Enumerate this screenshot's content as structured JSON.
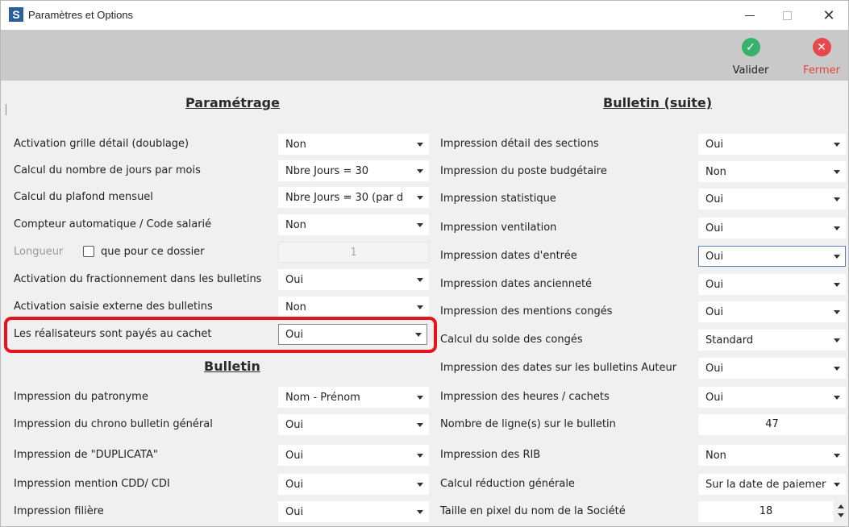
{
  "window": {
    "app_icon_letter": "S",
    "title": "Paramètres et Options"
  },
  "toolbar": {
    "validate_label": "Valider",
    "close_label": "Fermer"
  },
  "sections": {
    "left_title": "Paramétrage",
    "bulletin_title": "Bulletin",
    "right_title": "Bulletin (suite)"
  },
  "left_rows": [
    {
      "label": "Activation grille détail (doublage)",
      "value": "Non"
    },
    {
      "label": "Calcul du nombre de jours par mois",
      "value": "Nbre Jours = 30"
    },
    {
      "label": "Calcul du plafond mensuel",
      "value": "Nbre Jours = 30 (par d"
    },
    {
      "label": "Compteur automatique / Code salarié",
      "value": "Non"
    },
    {
      "label": "Longueur",
      "checkbox_label": "que pour ce dossier",
      "value": "1"
    },
    {
      "label": "Activation du fractionnement dans les bulletins",
      "value": "Oui"
    },
    {
      "label": "Activation saisie externe des bulletins",
      "value": "Non"
    },
    {
      "label": "Les réalisateurs sont payés au cachet",
      "value": "Oui"
    }
  ],
  "bulletin_rows": [
    {
      "label": "Impression du patronyme",
      "value": "Nom - Prénom"
    },
    {
      "label": "Impression du chrono bulletin général",
      "value": "Oui"
    },
    {
      "label": "Impression de \"DUPLICATA\"",
      "value": "Oui"
    },
    {
      "label": "Impression mention CDD/ CDI",
      "value": "Oui"
    },
    {
      "label": "Impression filière",
      "value": "Oui"
    }
  ],
  "right_rows": [
    {
      "label": "Impression détail des sections",
      "value": "Oui"
    },
    {
      "label": "Impression du poste budgétaire",
      "value": "Non"
    },
    {
      "label": "Impression statistique",
      "value": "Oui"
    },
    {
      "label": "Impression ventilation",
      "value": "Oui"
    },
    {
      "label": "Impression dates d'entrée",
      "value": "Oui"
    },
    {
      "label": "Impression dates ancienneté",
      "value": "Oui"
    },
    {
      "label": "Impression des mentions congés",
      "value": "Oui"
    },
    {
      "label": "Calcul du solde des congés",
      "value": "Standard"
    },
    {
      "label": "Impression des dates sur les bulletins Auteur",
      "value": "Oui"
    },
    {
      "label": "Impression des heures / cachets",
      "value": "Oui"
    },
    {
      "label": "Nombre de ligne(s) sur le bulletin",
      "value": "47"
    },
    {
      "label": "Impression des RIB",
      "value": "Non"
    },
    {
      "label": "Calcul réduction générale",
      "value": "Sur la date de paiemer"
    },
    {
      "label": "Taille en pixel du nom de la Société",
      "value": "18"
    }
  ],
  "colors": {
    "toolbar_bg": "#c9c9c9",
    "highlight_border": "#e8141c",
    "validate_icon": "#37b26c",
    "close_icon": "#e7484a"
  }
}
